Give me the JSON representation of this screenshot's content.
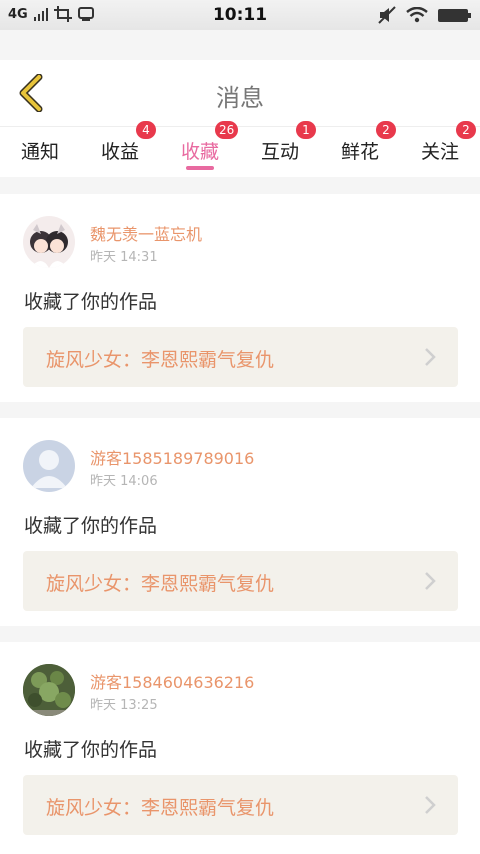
{
  "status_bar": {
    "network": "4G",
    "time": "10:11"
  },
  "header": {
    "title": "消息"
  },
  "tabs": [
    {
      "label": "通知",
      "badge": ""
    },
    {
      "label": "收益",
      "badge": "4"
    },
    {
      "label": "收藏",
      "badge": "26"
    },
    {
      "label": "互动",
      "badge": "1"
    },
    {
      "label": "鲜花",
      "badge": "2"
    },
    {
      "label": "关注",
      "badge": "2"
    }
  ],
  "messages": [
    {
      "user": "魏无羡一蓝忘机",
      "time": "昨天 14:31",
      "action": "收藏了你的作品",
      "work": "旋风少女：李恩熙霸气复仇",
      "avatar_icon": "anime-couple-avatar"
    },
    {
      "user": "游客1585189789016",
      "time": "昨天 14:06",
      "action": "收藏了你的作品",
      "work": "旋风少女：李恩熙霸气复仇",
      "avatar_icon": "default-user-avatar"
    },
    {
      "user": "游客1584604636216",
      "time": "昨天 13:25",
      "action": "收藏了你的作品",
      "work": "旋风少女：李恩熙霸气复仇",
      "avatar_icon": "plant-photo-avatar"
    }
  ],
  "colors": {
    "accent_pink": "#e86aa0",
    "badge_red": "#e8394c",
    "name_orange": "#e9956b",
    "back_arrow": "#e8c43a"
  }
}
